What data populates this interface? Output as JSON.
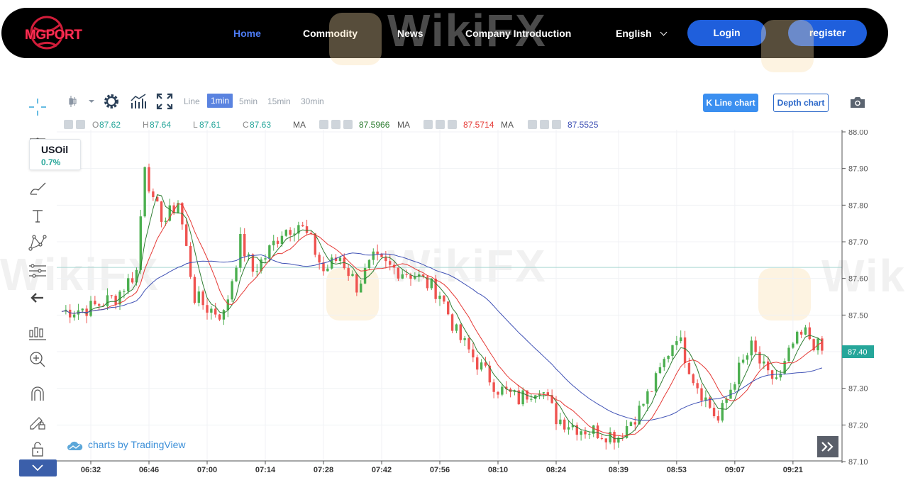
{
  "brand": {
    "name": "MGPORT"
  },
  "nav": {
    "items": [
      "Home",
      "Commodity",
      "News",
      "Company Introduction"
    ],
    "active_index": 0,
    "language": "English",
    "login_label": "Login",
    "register_label": "register"
  },
  "watermark": "WikiFX",
  "toolbar": {
    "chart_style_icon": "candles-icon",
    "timeframes": [
      "Line",
      "1min",
      "5min",
      "15min",
      "30min"
    ],
    "active_timeframe": "1min",
    "kline_label": "K Line chart",
    "depth_label": "Depth chart"
  },
  "symbol": {
    "name": "USOil",
    "change": "0.7%"
  },
  "legend": {
    "o_label": "O",
    "o_value": "87.62",
    "h_label": "H",
    "h_value": "87.64",
    "l_label": "L",
    "l_value": "87.61",
    "c_label": "C",
    "c_value": "87.63",
    "ma1_label": "MA",
    "ma1_value": "87.5966",
    "ma2_label": "MA",
    "ma2_value": "87.5714",
    "ma3_label": "MA",
    "ma3_value": "87.5525"
  },
  "credit": "charts by TradingView",
  "colors": {
    "up": "#26a69a",
    "up_candle": "#4caf50",
    "down": "#ef5350",
    "ma1": "#2e7d32",
    "ma2": "#e53935",
    "ma3": "#3f51b5",
    "last_price_bg": "#26a69a",
    "accent": "#1f5fdc"
  },
  "chart_data": {
    "type": "candlestick",
    "price_axis": {
      "ticks": [
        "87.10",
        "87.20",
        "87.30",
        "87.40",
        "87.50",
        "87.60",
        "87.70",
        "87.80",
        "87.90",
        "88.00"
      ],
      "range": [
        87.1,
        88.0
      ]
    },
    "time_axis": {
      "ticks": [
        "06:32",
        "06:46",
        "07:00",
        "07:14",
        "07:28",
        "07:42",
        "07:56",
        "08:10",
        "08:24",
        "08:39",
        "08:53",
        "09:07",
        "09:21"
      ]
    },
    "last_price": "87.40",
    "horizontal_line": 87.63,
    "close_path": [
      [
        "06:25",
        87.51
      ],
      [
        "06:32",
        87.52
      ],
      [
        "06:38",
        87.55
      ],
      [
        "06:43",
        87.62
      ],
      [
        "06:45",
        87.92
      ],
      [
        "06:47",
        87.8
      ],
      [
        "06:50",
        87.76
      ],
      [
        "06:53",
        87.81
      ],
      [
        "06:57",
        87.55
      ],
      [
        "07:00",
        87.52
      ],
      [
        "07:04",
        87.5
      ],
      [
        "07:08",
        87.7
      ],
      [
        "07:11",
        87.62
      ],
      [
        "07:14",
        87.66
      ],
      [
        "07:18",
        87.73
      ],
      [
        "07:22",
        87.75
      ],
      [
        "07:25",
        87.7
      ],
      [
        "07:28",
        87.62
      ],
      [
        "07:32",
        87.66
      ],
      [
        "07:36",
        87.58
      ],
      [
        "07:40",
        87.65
      ],
      [
        "07:44",
        87.63
      ],
      [
        "07:50",
        87.61
      ],
      [
        "07:56",
        87.56
      ],
      [
        "08:00",
        87.45
      ],
      [
        "08:05",
        87.37
      ],
      [
        "08:10",
        87.3
      ],
      [
        "08:15",
        87.27
      ],
      [
        "08:20",
        87.31
      ],
      [
        "08:24",
        87.22
      ],
      [
        "08:30",
        87.19
      ],
      [
        "08:35",
        87.18
      ],
      [
        "08:39",
        87.17
      ],
      [
        "08:44",
        87.24
      ],
      [
        "08:48",
        87.32
      ],
      [
        "08:51",
        87.4
      ],
      [
        "08:53",
        87.45
      ],
      [
        "08:57",
        87.33
      ],
      [
        "09:00",
        87.27
      ],
      [
        "09:03",
        87.21
      ],
      [
        "09:07",
        87.33
      ],
      [
        "09:11",
        87.41
      ],
      [
        "09:15",
        87.33
      ],
      [
        "09:18",
        87.33
      ],
      [
        "09:21",
        87.42
      ],
      [
        "09:24",
        87.45
      ],
      [
        "09:28",
        87.4
      ]
    ]
  }
}
